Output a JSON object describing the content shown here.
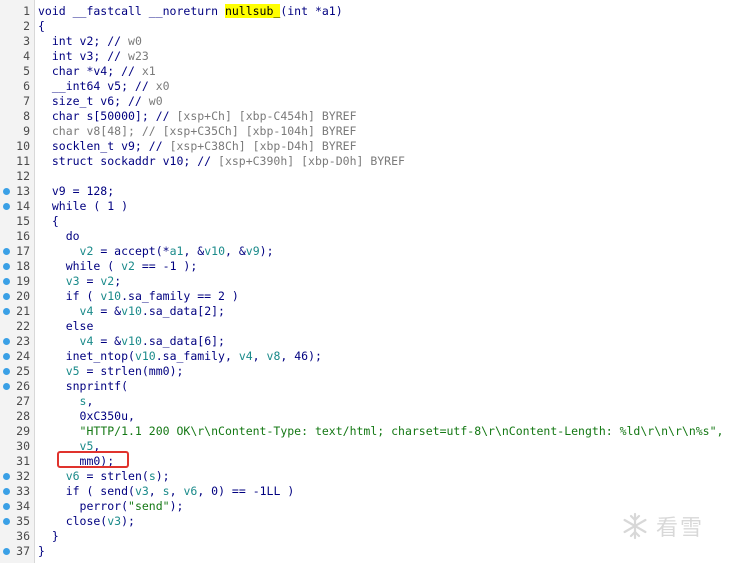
{
  "editor": {
    "lines": [
      {
        "num": "1",
        "bp": false,
        "tokens": [
          {
            "t": "void __fastcall __noreturn ",
            "c": "k"
          },
          {
            "t": "nullsub_",
            "c": "hl"
          },
          {
            "t": "(int *a1)",
            "c": "k"
          }
        ]
      },
      {
        "num": "2",
        "bp": false,
        "tokens": [
          {
            "t": "{",
            "c": "k"
          }
        ]
      },
      {
        "num": "3",
        "bp": false,
        "tokens": [
          {
            "t": "  int v2; // ",
            "c": "k"
          },
          {
            "t": "w0",
            "c": "c"
          }
        ]
      },
      {
        "num": "4",
        "bp": false,
        "tokens": [
          {
            "t": "  int v3; // ",
            "c": "k"
          },
          {
            "t": "w23",
            "c": "c"
          }
        ]
      },
      {
        "num": "5",
        "bp": false,
        "tokens": [
          {
            "t": "  char *v4; // ",
            "c": "k"
          },
          {
            "t": "x1",
            "c": "c"
          }
        ]
      },
      {
        "num": "6",
        "bp": false,
        "tokens": [
          {
            "t": "  __int64 v5; // ",
            "c": "k"
          },
          {
            "t": "x0",
            "c": "c"
          }
        ]
      },
      {
        "num": "7",
        "bp": false,
        "tokens": [
          {
            "t": "  size_t v6; // ",
            "c": "k"
          },
          {
            "t": "w0",
            "c": "c"
          }
        ]
      },
      {
        "num": "8",
        "bp": false,
        "tokens": [
          {
            "t": "  char s[50000]; // ",
            "c": "k"
          },
          {
            "t": "[xsp+Ch] [xbp-C454h] BYREF",
            "c": "c"
          }
        ]
      },
      {
        "num": "9",
        "bp": false,
        "tokens": [
          {
            "t": "  char v8[48]; // [xsp+C35Ch] [xbp-104h] BYREF",
            "c": "c"
          }
        ]
      },
      {
        "num": "10",
        "bp": false,
        "tokens": [
          {
            "t": "  socklen_t v9; // ",
            "c": "k"
          },
          {
            "t": "[xsp+C38Ch] [xbp-D4h] BYREF",
            "c": "c"
          }
        ]
      },
      {
        "num": "11",
        "bp": false,
        "tokens": [
          {
            "t": "  struct sockaddr v10; // ",
            "c": "k"
          },
          {
            "t": "[xsp+C390h] [xbp-D0h] BYREF",
            "c": "c"
          }
        ]
      },
      {
        "num": "12",
        "bp": false,
        "tokens": [
          {
            "t": "",
            "c": "k"
          }
        ]
      },
      {
        "num": "13",
        "bp": true,
        "tokens": [
          {
            "t": "  v9 = 128;",
            "c": "k"
          }
        ]
      },
      {
        "num": "14",
        "bp": true,
        "tokens": [
          {
            "t": "  while ( 1 )",
            "c": "k"
          }
        ]
      },
      {
        "num": "15",
        "bp": false,
        "tokens": [
          {
            "t": "  {",
            "c": "k"
          }
        ]
      },
      {
        "num": "16",
        "bp": false,
        "tokens": [
          {
            "t": "    do",
            "c": "k"
          }
        ]
      },
      {
        "num": "17",
        "bp": true,
        "tokens": [
          {
            "t": "      ",
            "c": "k"
          },
          {
            "t": "v2",
            "c": "v"
          },
          {
            "t": " = accept(*",
            "c": "k"
          },
          {
            "t": "a1",
            "c": "v"
          },
          {
            "t": ", &",
            "c": "k"
          },
          {
            "t": "v10",
            "c": "v"
          },
          {
            "t": ", &",
            "c": "k"
          },
          {
            "t": "v9",
            "c": "v"
          },
          {
            "t": ");",
            "c": "k"
          }
        ]
      },
      {
        "num": "18",
        "bp": true,
        "tokens": [
          {
            "t": "    while ( ",
            "c": "k"
          },
          {
            "t": "v2",
            "c": "v"
          },
          {
            "t": " == -1 );",
            "c": "k"
          }
        ]
      },
      {
        "num": "19",
        "bp": true,
        "tokens": [
          {
            "t": "    ",
            "c": "k"
          },
          {
            "t": "v3",
            "c": "v"
          },
          {
            "t": " = ",
            "c": "k"
          },
          {
            "t": "v2",
            "c": "v"
          },
          {
            "t": ";",
            "c": "k"
          }
        ]
      },
      {
        "num": "20",
        "bp": true,
        "tokens": [
          {
            "t": "    if ( ",
            "c": "k"
          },
          {
            "t": "v10",
            "c": "v"
          },
          {
            "t": ".sa_family == 2 )",
            "c": "k"
          }
        ]
      },
      {
        "num": "21",
        "bp": true,
        "tokens": [
          {
            "t": "      ",
            "c": "k"
          },
          {
            "t": "v4",
            "c": "v"
          },
          {
            "t": " = &",
            "c": "k"
          },
          {
            "t": "v10",
            "c": "v"
          },
          {
            "t": ".sa_data[2];",
            "c": "k"
          }
        ]
      },
      {
        "num": "22",
        "bp": false,
        "tokens": [
          {
            "t": "    else",
            "c": "k"
          }
        ]
      },
      {
        "num": "23",
        "bp": true,
        "tokens": [
          {
            "t": "      ",
            "c": "k"
          },
          {
            "t": "v4",
            "c": "v"
          },
          {
            "t": " = &",
            "c": "k"
          },
          {
            "t": "v10",
            "c": "v"
          },
          {
            "t": ".sa_data[6];",
            "c": "k"
          }
        ]
      },
      {
        "num": "24",
        "bp": true,
        "tokens": [
          {
            "t": "    inet_ntop(",
            "c": "k"
          },
          {
            "t": "v10",
            "c": "v"
          },
          {
            "t": ".sa_family, ",
            "c": "k"
          },
          {
            "t": "v4",
            "c": "v"
          },
          {
            "t": ", ",
            "c": "k"
          },
          {
            "t": "v8",
            "c": "v"
          },
          {
            "t": ", 46);",
            "c": "k"
          }
        ]
      },
      {
        "num": "25",
        "bp": true,
        "tokens": [
          {
            "t": "    ",
            "c": "k"
          },
          {
            "t": "v5",
            "c": "v"
          },
          {
            "t": " = strlen(mm0);",
            "c": "k"
          }
        ]
      },
      {
        "num": "26",
        "bp": true,
        "tokens": [
          {
            "t": "    snprintf(",
            "c": "k"
          }
        ]
      },
      {
        "num": "27",
        "bp": false,
        "tokens": [
          {
            "t": "      ",
            "c": "k"
          },
          {
            "t": "s",
            "c": "v"
          },
          {
            "t": ",",
            "c": "k"
          }
        ]
      },
      {
        "num": "28",
        "bp": false,
        "tokens": [
          {
            "t": "      0xC350u,",
            "c": "k"
          }
        ]
      },
      {
        "num": "29",
        "bp": false,
        "tokens": [
          {
            "t": "      ",
            "c": "k"
          },
          {
            "t": "\"HTTP/1.1 200 OK\\r\\nContent-Type: text/html; charset=utf-8\\r\\nContent-Length: %ld\\r\\n\\r\\n%s\",",
            "c": "s"
          }
        ]
      },
      {
        "num": "30",
        "bp": false,
        "tokens": [
          {
            "t": "      ",
            "c": "k"
          },
          {
            "t": "v5",
            "c": "v"
          },
          {
            "t": ",",
            "c": "k"
          }
        ]
      },
      {
        "num": "31",
        "bp": false,
        "tokens": [
          {
            "t": "      mm0);",
            "c": "k"
          }
        ]
      },
      {
        "num": "32",
        "bp": true,
        "tokens": [
          {
            "t": "    ",
            "c": "k"
          },
          {
            "t": "v6",
            "c": "v"
          },
          {
            "t": " = strlen(",
            "c": "k"
          },
          {
            "t": "s",
            "c": "v"
          },
          {
            "t": ");",
            "c": "k"
          }
        ]
      },
      {
        "num": "33",
        "bp": true,
        "tokens": [
          {
            "t": "    if ( send(",
            "c": "k"
          },
          {
            "t": "v3",
            "c": "v"
          },
          {
            "t": ", ",
            "c": "k"
          },
          {
            "t": "s",
            "c": "v"
          },
          {
            "t": ", ",
            "c": "k"
          },
          {
            "t": "v6",
            "c": "v"
          },
          {
            "t": ", 0) == -1LL )",
            "c": "k"
          }
        ]
      },
      {
        "num": "34",
        "bp": true,
        "tokens": [
          {
            "t": "      perror(",
            "c": "k"
          },
          {
            "t": "\"send\"",
            "c": "s"
          },
          {
            "t": ");",
            "c": "k"
          }
        ]
      },
      {
        "num": "35",
        "bp": true,
        "tokens": [
          {
            "t": "    close(",
            "c": "k"
          },
          {
            "t": "v3",
            "c": "v"
          },
          {
            "t": ");",
            "c": "k"
          }
        ]
      },
      {
        "num": "36",
        "bp": false,
        "tokens": [
          {
            "t": "  }",
            "c": "k"
          }
        ]
      },
      {
        "num": "37",
        "bp": true,
        "tokens": [
          {
            "t": "}",
            "c": "k"
          }
        ]
      }
    ]
  },
  "watermark": {
    "text": "看雪",
    "icon": "snowflake-icon"
  },
  "colors": {
    "highlight": "#ffff00",
    "callout": "#e0332d",
    "breakpoint": "#3aa0e6"
  }
}
